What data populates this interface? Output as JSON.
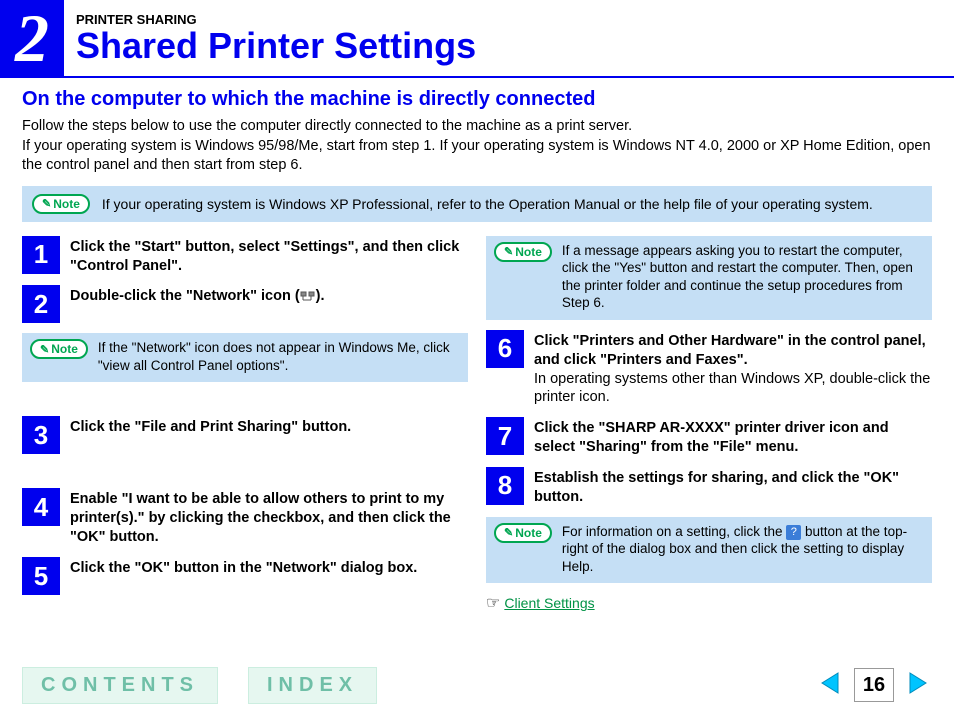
{
  "header": {
    "chapter_number": "2",
    "kicker": "PRINTER SHARING",
    "title": "Shared Printer Settings"
  },
  "section_title": "On the computer to which the machine is directly connected",
  "intro": "Follow the steps below to use the computer directly connected to the machine as a print server.\nIf your operating system is Windows 95/98/Me, start from step 1. If your operating system is Windows NT 4.0, 2000 or XP Home Edition, open the control panel and then start from step 6.",
  "top_note": {
    "label": "Note",
    "text": "If your operating system is Windows XP Professional, refer to the Operation Manual or the help file of your operating system."
  },
  "left_steps": [
    {
      "num": "1",
      "bold": "Click the \"Start\" button, select \"Settings\", and then click \"Control Panel\"."
    },
    {
      "num": "2",
      "bold_prefix": "Double-click the \"Network\" icon (",
      "bold_suffix": ")."
    }
  ],
  "left_note": {
    "label": "Note",
    "text": "If the \"Network\" icon does not appear in Windows Me, click \"view all Control Panel options\"."
  },
  "left_steps2": [
    {
      "num": "3",
      "bold": "Click the \"File and Print Sharing\" button."
    },
    {
      "num": "4",
      "bold": "Enable \"I want to be able to allow others to print to my printer(s).\" by clicking the checkbox, and then click the \"OK\" button."
    },
    {
      "num": "5",
      "bold": "Click the \"OK\" button in the \"Network\" dialog box."
    }
  ],
  "right_note_top": {
    "label": "Note",
    "text": "If a message appears asking you to restart the computer, click the \"Yes\" button and restart the computer. Then, open the printer folder and continue the setup procedures from Step 6."
  },
  "right_steps": [
    {
      "num": "6",
      "bold": "Click \"Printers and Other Hardware\" in the control panel, and click \"Printers and Faxes\".",
      "sub": "In operating systems other than Windows XP, double-click the printer icon."
    },
    {
      "num": "7",
      "bold": "Click the \"SHARP AR-XXXX\" printer driver icon and select \"Sharing\" from the \"File\" menu."
    },
    {
      "num": "8",
      "bold": "Establish the settings for sharing, and click the \"OK\" button."
    }
  ],
  "right_note_bottom": {
    "label": "Note",
    "text_before": "For information on a setting, click the ",
    "help_glyph": "?",
    "text_after": " button at the top-right of the dialog box and then click the setting to display Help."
  },
  "client_link": "Client Settings",
  "footer": {
    "contents": "CONTENTS",
    "index": "INDEX",
    "page_number": "16"
  }
}
